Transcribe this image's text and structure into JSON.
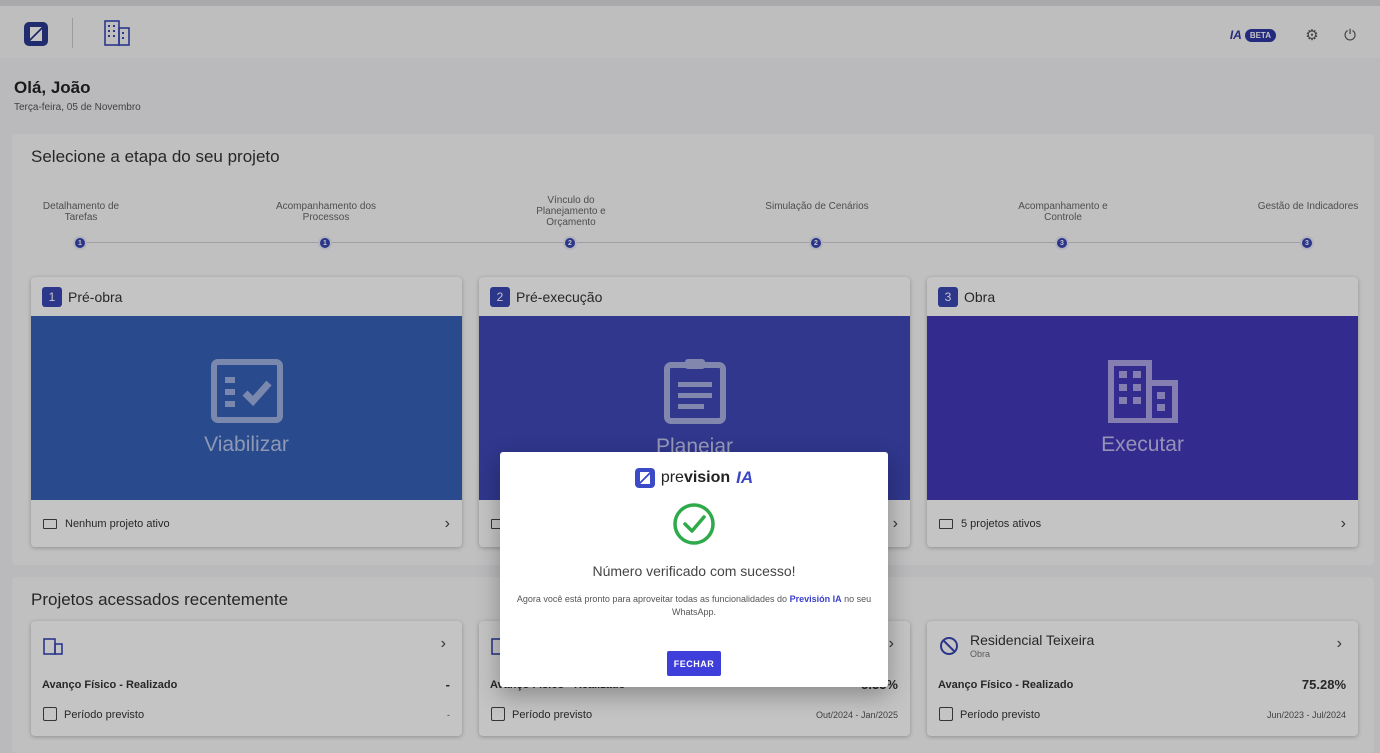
{
  "header": {
    "ia_label": "IA",
    "beta_label": "BETA",
    "settings_icon": "gear-icon",
    "power_icon": "power-icon"
  },
  "greeting": "Olá, João",
  "date": "Terça-feira, 05 de Novembro",
  "stages_panel": {
    "title": "Selecione a etapa do seu projeto",
    "steps": [
      {
        "label": "Detalhamento de Tarefas",
        "num": "1"
      },
      {
        "label": "Acompanhamento dos Processos",
        "num": "1"
      },
      {
        "label": "Vínculo do Planejamento e Orçamento",
        "num": "2"
      },
      {
        "label": "Simulação de Cenários",
        "num": "2"
      },
      {
        "label": "Acompanhamento e Controle",
        "num": "3"
      },
      {
        "label": "Gestão de Indicadores",
        "num": "3"
      }
    ],
    "cards": [
      {
        "num": "1",
        "title": "Pré-obra",
        "action": "Viabilizar",
        "footer": "Nenhum projeto ativo",
        "color": "#3661b8"
      },
      {
        "num": "2",
        "title": "Pré-execução",
        "action": "Planejar",
        "footer": "",
        "color": "#3f48b8"
      },
      {
        "num": "3",
        "title": "Obra",
        "action": "Executar",
        "footer": "5 projetos ativos",
        "color": "#4439ba"
      }
    ]
  },
  "recent_panel": {
    "title": "Projetos acessados recentemente",
    "projects": [
      {
        "name": "",
        "subtitle": "",
        "avanco_label": "Avanço Físico - Realizado",
        "avanco_value": "-",
        "periodo_label": "Período previsto",
        "periodo_value": "-"
      },
      {
        "name": "",
        "subtitle": "",
        "avanco_label": "Avanço Físico - Realizado",
        "avanco_value": "5.33%",
        "periodo_label": "Período previsto",
        "periodo_value": "Out/2024 - Jan/2025"
      },
      {
        "name": "Residencial Teixeira",
        "subtitle": "Obra",
        "avanco_label": "Avanço Físico - Realizado",
        "avanco_value": "75.28%",
        "periodo_label": "Período previsto",
        "periodo_value": "Jun/2023 - Jul/2024"
      }
    ]
  },
  "modal": {
    "brand_pre": "pre",
    "brand_bold": "vision",
    "brand_ia": "IA",
    "title": "Número verificado com sucesso!",
    "text_before": "Agora você está pronto para aproveitar todas as funcionalidades do ",
    "text_highlight": "Previsión IA",
    "text_after": " no seu WhatsApp.",
    "button": "FECHAR",
    "success_color": "#2eaa4a"
  }
}
